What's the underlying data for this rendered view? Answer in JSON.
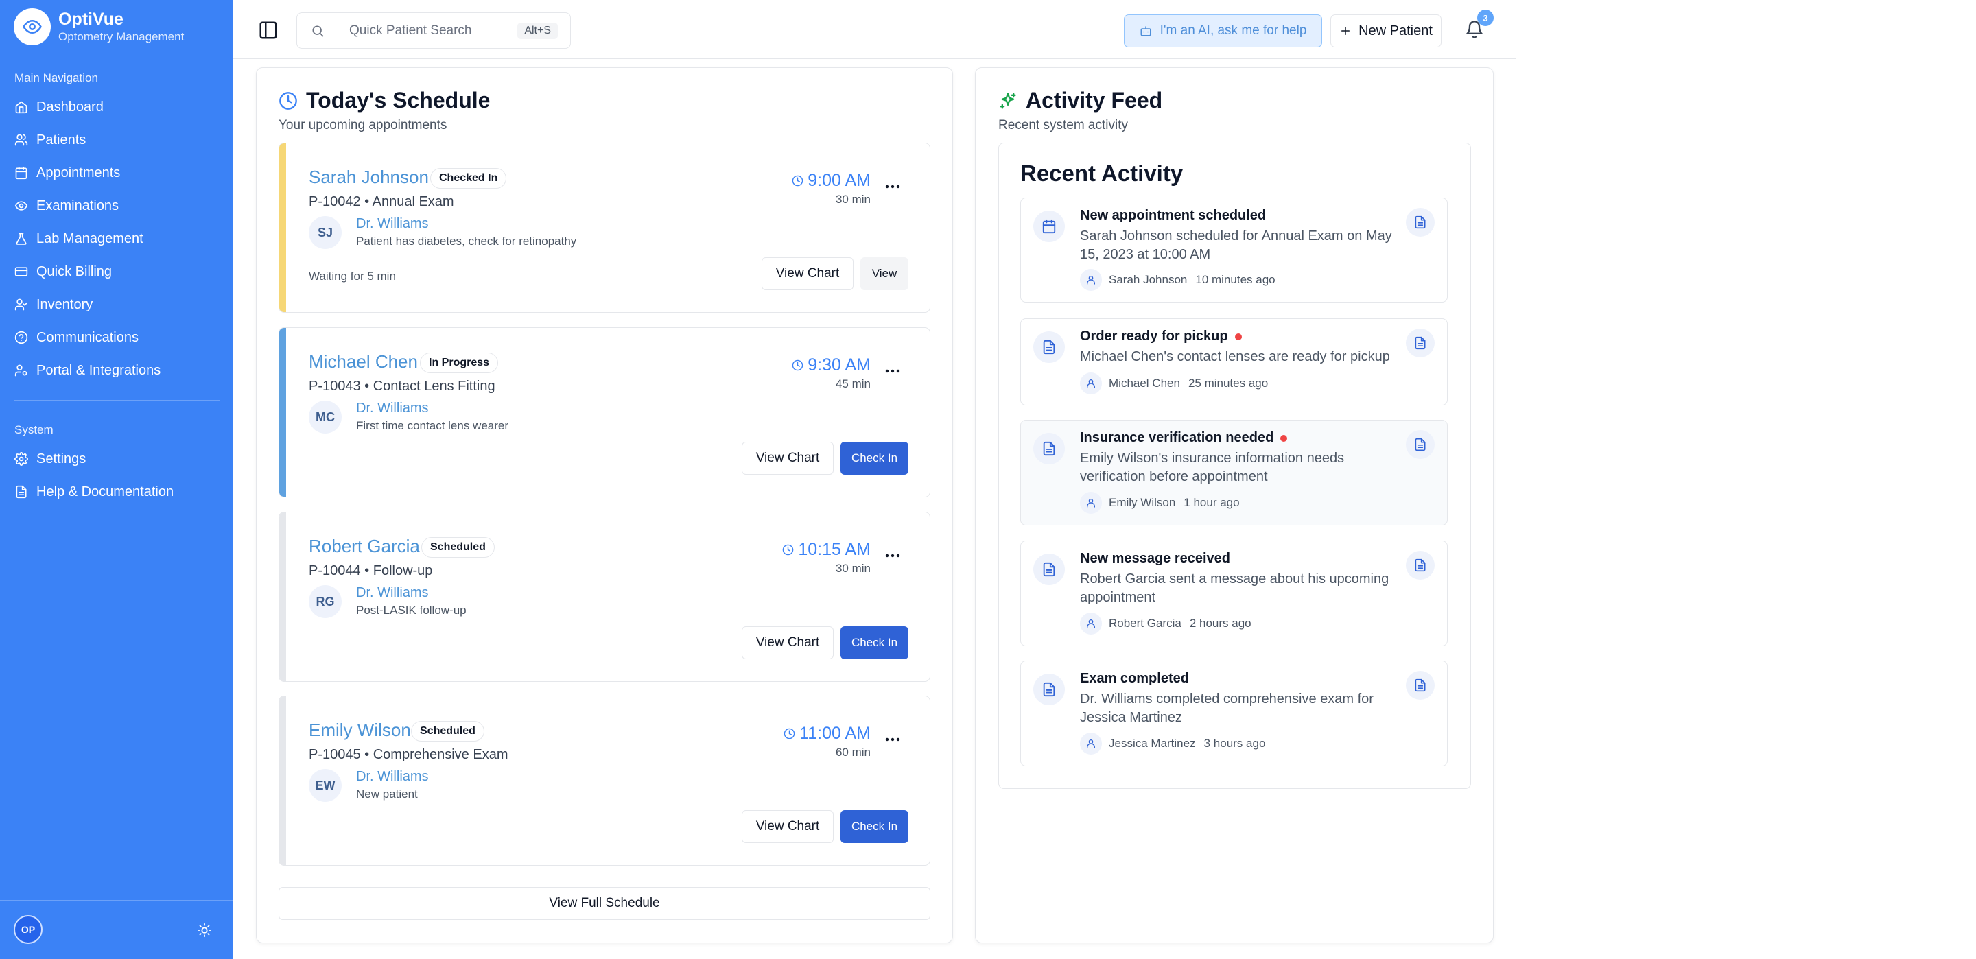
{
  "brand": {
    "name": "OptiVue",
    "subtitle": "Optometry Management"
  },
  "sidebar": {
    "main_label": "Main Navigation",
    "items": [
      {
        "label": "Dashboard",
        "icon": "home-icon"
      },
      {
        "label": "Patients",
        "icon": "users-icon"
      },
      {
        "label": "Appointments",
        "icon": "calendar-icon"
      },
      {
        "label": "Examinations",
        "icon": "eye-icon"
      },
      {
        "label": "Lab Management",
        "icon": "flask-icon"
      },
      {
        "label": "Quick Billing",
        "icon": "credit-card-icon"
      },
      {
        "label": "Inventory",
        "icon": "user-check-icon"
      },
      {
        "label": "Communications",
        "icon": "help-circle-icon"
      },
      {
        "label": "Portal & Integrations",
        "icon": "user-cog-icon"
      }
    ],
    "system_label": "System",
    "system_items": [
      {
        "label": "Settings",
        "icon": "gear-icon"
      },
      {
        "label": "Help & Documentation",
        "icon": "document-icon"
      }
    ],
    "user_initials": "OP"
  },
  "topbar": {
    "search_placeholder": "Quick Patient Search",
    "search_shortcut": "Alt+S",
    "ai_button": "I'm an AI, ask me for help",
    "new_patient": "New Patient",
    "notification_count": "3"
  },
  "schedule": {
    "title": "Today's Schedule",
    "subtitle": "Your upcoming appointments",
    "view_full": "View Full Schedule",
    "appointments": [
      {
        "name": "Sarah Johnson",
        "status": "Checked In",
        "id_type": "P-10042 • Annual Exam",
        "initials": "SJ",
        "doctor": "Dr. Williams",
        "note": "Patient has diabetes, check for retinopathy",
        "time": "9:00 AM",
        "duration": "30 min",
        "wait": "Waiting for 5 min",
        "chart_btn": "View Chart",
        "action_btn": "View",
        "accent": "#f6d776"
      },
      {
        "name": "Michael Chen",
        "status": "In Progress",
        "id_type": "P-10043 • Contact Lens Fitting",
        "initials": "MC",
        "doctor": "Dr. Williams",
        "note": "First time contact lens wearer",
        "time": "9:30 AM",
        "duration": "45 min",
        "wait": "",
        "chart_btn": "View Chart",
        "action_btn": "Check In",
        "accent": "#5fa2e0"
      },
      {
        "name": "Robert Garcia",
        "status": "Scheduled",
        "id_type": "P-10044 • Follow-up",
        "initials": "RG",
        "doctor": "Dr. Williams",
        "note": "Post-LASIK follow-up",
        "time": "10:15 AM",
        "duration": "30 min",
        "wait": "",
        "chart_btn": "View Chart",
        "action_btn": "Check In",
        "accent": "#e5e7eb"
      },
      {
        "name": "Emily Wilson",
        "status": "Scheduled",
        "id_type": "P-10045 • Comprehensive Exam",
        "initials": "EW",
        "doctor": "Dr. Williams",
        "note": "New patient",
        "time": "11:00 AM",
        "duration": "60 min",
        "wait": "",
        "chart_btn": "View Chart",
        "action_btn": "Check In",
        "accent": "#e5e7eb"
      }
    ]
  },
  "activity": {
    "title": "Activity Feed",
    "subtitle": "Recent system activity",
    "recent_title": "Recent Activity",
    "items": [
      {
        "title": "New appointment scheduled",
        "desc": "Sarah Johnson scheduled for Annual Exam on May 15, 2023 at 10:00 AM",
        "user": "Sarah Johnson",
        "time": "10 minutes ago",
        "icon": "calendar-icon",
        "unread": false
      },
      {
        "title": "Order ready for pickup",
        "desc": "Michael Chen's contact lenses are ready for pickup",
        "user": "Michael Chen",
        "time": "25 minutes ago",
        "icon": "document-icon",
        "unread": true
      },
      {
        "title": "Insurance verification needed",
        "desc": "Emily Wilson's insurance information needs verification before appointment",
        "user": "Emily Wilson",
        "time": "1 hour ago",
        "icon": "document-icon",
        "unread": true
      },
      {
        "title": "New message received",
        "desc": "Robert Garcia sent a message about his upcoming appointment",
        "user": "Robert Garcia",
        "time": "2 hours ago",
        "icon": "document-icon",
        "unread": false
      },
      {
        "title": "Exam completed",
        "desc": "Dr. Williams completed comprehensive exam for Jessica Martinez",
        "user": "Jessica Martinez",
        "time": "3 hours ago",
        "icon": "document-icon",
        "unread": false
      }
    ]
  },
  "colors": {
    "sidebar": "#3b82f6",
    "primary": "#2f62d6",
    "link": "#4b93d6",
    "unread": "#ef4444"
  }
}
